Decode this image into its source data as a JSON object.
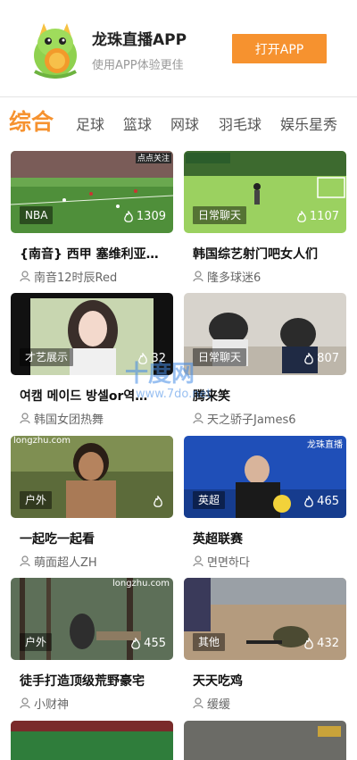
{
  "banner": {
    "app_name": "龙珠直播APP",
    "subtitle": "使用APP体验更佳",
    "open_button": "打开APP",
    "accent_color": "#f6922f"
  },
  "tabs": [
    {
      "label": "综合",
      "active": true
    },
    {
      "label": "足球",
      "active": false
    },
    {
      "label": "篮球",
      "active": false
    },
    {
      "label": "网球",
      "active": false
    },
    {
      "label": "羽毛球",
      "active": false
    },
    {
      "label": "娱乐星秀",
      "active": false
    }
  ],
  "cards": [
    {
      "badge": "NBA",
      "viewers": "1309",
      "title": "{南音} 西甲 塞维利亚…",
      "host": "南音12时辰Red",
      "thumb_text": "点点关注"
    },
    {
      "badge": "日常聊天",
      "viewers": "1107",
      "title": "韩国综艺射门吧女人们",
      "host": "隆多球迷6",
      "thumb_text": ""
    },
    {
      "badge": "才艺展示",
      "viewers": "32",
      "title": "여캠 메이드 방셀or역…",
      "host": "韩国女团热舞",
      "thumb_text": ""
    },
    {
      "badge": "日常聊天",
      "viewers": "807",
      "title": "腾来笑",
      "host": "天之骄子James6",
      "thumb_text": ""
    },
    {
      "badge": "户外",
      "viewers": "",
      "title": "一起吃一起看",
      "host": "萌面超人ZH",
      "thumb_text": "longzhu.com"
    },
    {
      "badge": "英超",
      "viewers": "465",
      "title": "英超联赛",
      "host": "면면하다",
      "thumb_text": "龙珠直播"
    },
    {
      "badge": "户外",
      "viewers": "455",
      "title": "徒手打造顶级荒野豪宅",
      "host": "小财神",
      "thumb_text": "longzhu.com"
    },
    {
      "badge": "其他",
      "viewers": "432",
      "title": "天天吃鸡",
      "host": "缓缓",
      "thumb_text": ""
    }
  ],
  "watermark": {
    "line1": "十度网",
    "line2": "www.7do.net"
  }
}
